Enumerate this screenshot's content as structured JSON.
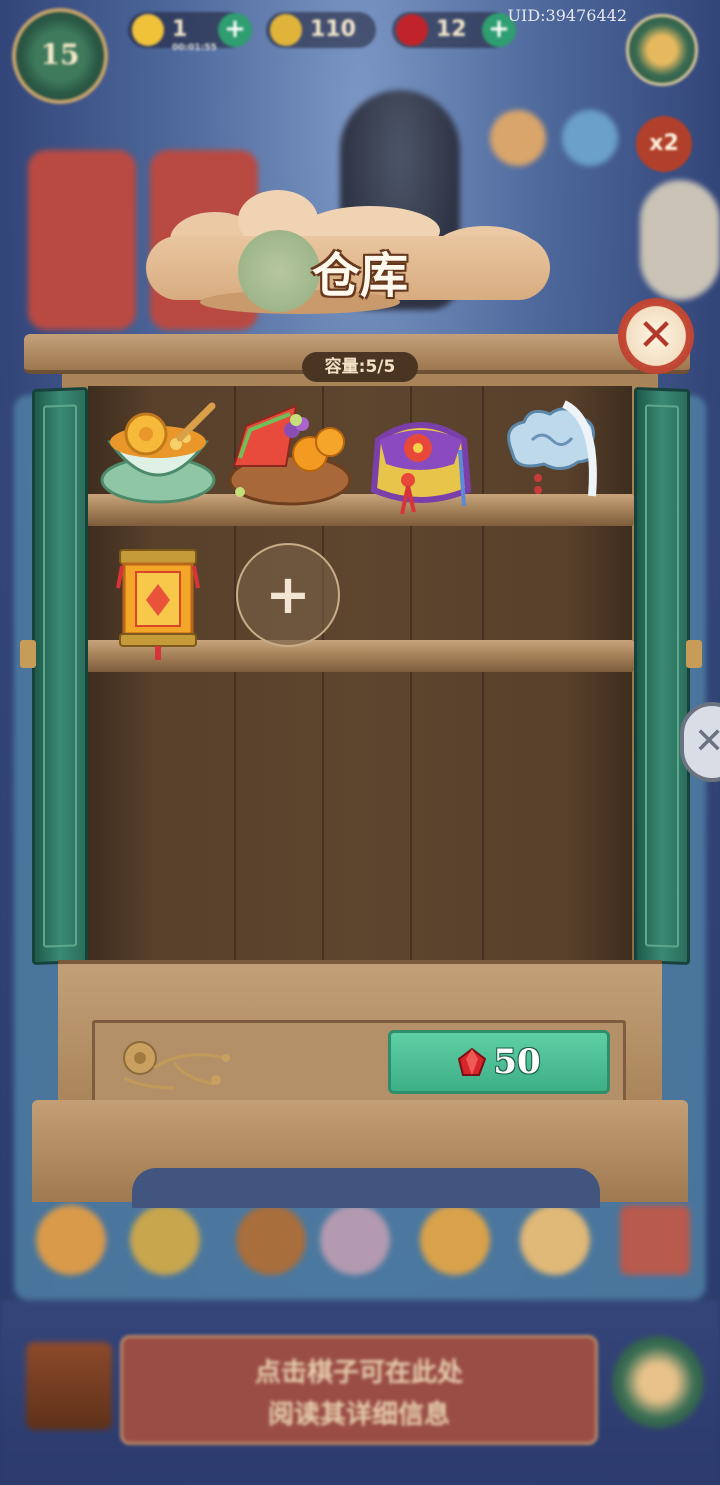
{
  "hud": {
    "level": "15",
    "energy": "1",
    "energy_timer": "00:01:55",
    "coins": "110",
    "gems": "12",
    "uid": "UID:39476442",
    "boost_badge": "x2"
  },
  "background_tip": {
    "line1": "点击棋子可在此处",
    "line2": "阅读其详细信息"
  },
  "dialog": {
    "title": "仓库",
    "capacity": "容量:5/5",
    "items": [
      {
        "name": "sweet-soup-bowl",
        "shelf": 1
      },
      {
        "name": "fruit-basket",
        "shelf": 1
      },
      {
        "name": "embroidered-pouch",
        "shelf": 1
      },
      {
        "name": "cloud-jade-pendant",
        "shelf": 1
      },
      {
        "name": "palace-lantern",
        "shelf": 2
      }
    ],
    "add_slot_label": "+",
    "expand_price": "50",
    "close_label": "✕"
  },
  "colors": {
    "wood": "#a98559",
    "door_green": "#2a6e5c",
    "buy_button": "#4dbf96",
    "close_red": "#b3382a"
  }
}
